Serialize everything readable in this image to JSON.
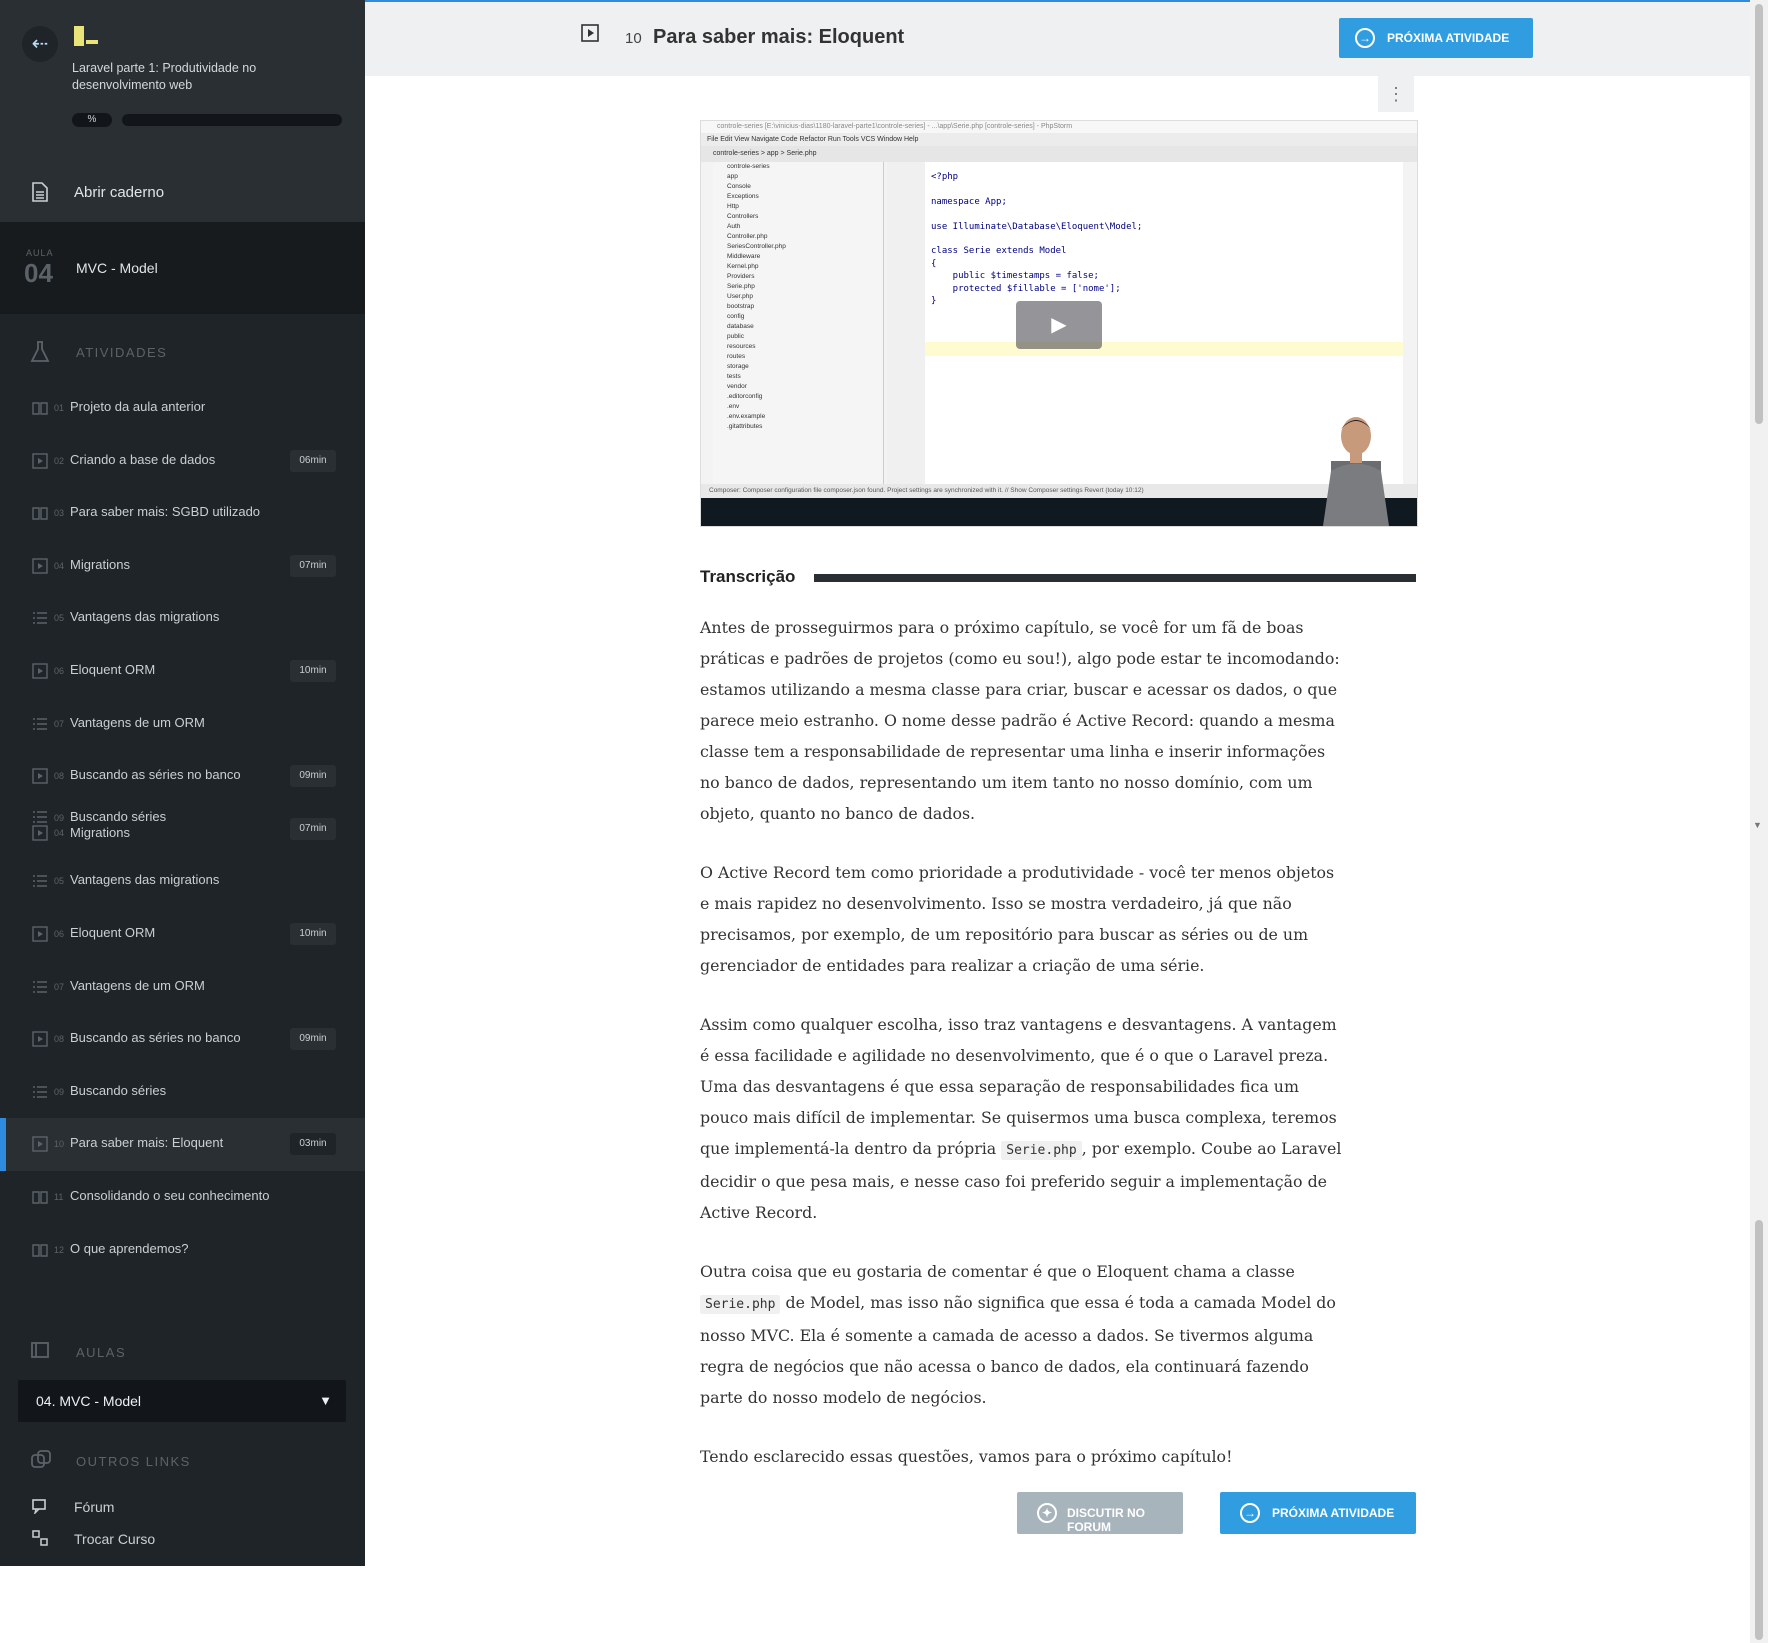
{
  "course": {
    "title": "Laravel parte 1: Produtividade no desenvolvimento web",
    "progress_label": "%",
    "progress_fraction": 0
  },
  "notebook": {
    "label": "Abrir caderno"
  },
  "aula": {
    "small": "AULA",
    "number": "04",
    "title": "MVC - Model"
  },
  "activities": {
    "heading": "ATIVIDADES",
    "items": [
      {
        "no": "01",
        "label": "Projeto da aula anterior",
        "duration": "",
        "icon": "book-icon"
      },
      {
        "no": "02",
        "label": "Criando a base de dados",
        "duration": "06min",
        "icon": "video-icon"
      },
      {
        "no": "03",
        "label": "Para saber mais: SGBD utilizado",
        "duration": "",
        "icon": "book-icon"
      },
      {
        "no": "04",
        "label": "Migrations",
        "duration": "07min",
        "icon": "video-icon"
      },
      {
        "no": "05",
        "label": "Vantagens das migrations",
        "duration": "",
        "icon": "list-icon"
      },
      {
        "no": "06",
        "label": "Eloquent ORM",
        "duration": "10min",
        "icon": "video-icon"
      },
      {
        "no": "07",
        "label": "Vantagens de um ORM",
        "duration": "",
        "icon": "list-icon"
      },
      {
        "no": "08",
        "label": "Buscando as séries no banco",
        "duration": "09min",
        "icon": "video-icon"
      },
      {
        "no": "09",
        "label": "Buscando séries",
        "no2": "04",
        "label2": "Migrations",
        "duration": "07min",
        "icon": "list-icon",
        "double": true
      },
      {
        "no": "05",
        "label": "Vantagens das migrations",
        "duration": "",
        "icon": "list-icon"
      },
      {
        "no": "06",
        "label": "Eloquent ORM",
        "duration": "10min",
        "icon": "video-icon"
      },
      {
        "no": "07",
        "label": "Vantagens de um ORM",
        "duration": "",
        "icon": "list-icon"
      },
      {
        "no": "08",
        "label": "Buscando as séries no banco",
        "duration": "09min",
        "icon": "video-icon"
      },
      {
        "no": "09",
        "label": "Buscando séries",
        "duration": "",
        "icon": "list-icon"
      },
      {
        "no": "10",
        "label": "Para saber mais: Eloquent",
        "duration": "03min",
        "icon": "video-icon",
        "active": true
      },
      {
        "no": "11",
        "label": "Consolidando o seu conhecimento",
        "duration": "",
        "icon": "book-icon"
      },
      {
        "no": "12",
        "label": "O que aprendemos?",
        "duration": "",
        "icon": "book-icon"
      }
    ]
  },
  "aulas": {
    "heading": "AULAS",
    "selected": "04. MVC - Model"
  },
  "other_links": {
    "heading": "OUTROS LINKS",
    "forum": "Fórum",
    "switch_course": "Trocar Curso"
  },
  "header": {
    "activity_number": "10",
    "activity_title": "Para saber mais: Eloquent",
    "next_label": "PRÓXIMA ATIVIDADE"
  },
  "video": {
    "ide_title": "controle-series [E:\\vinicius-dias\\1180-laravel-parte1\\controle-series] - ...\\app\\Serie.php [controle-series] - PhpStorm",
    "ide_menu": "File  Edit  View  Navigate  Code  Refactor  Run  Tools  VCS  Window  Help",
    "ide_nav": "controle-series  >  app  >  Serie.php",
    "tree": [
      "controle-series",
      "app",
      "Console",
      "Exceptions",
      "Http",
      "Controllers",
      "Auth",
      "Controller.php",
      "SeriesController.php",
      "Middleware",
      "Kernel.php",
      "Providers",
      "Serie.php",
      "User.php",
      "bootstrap",
      "config",
      "database",
      "public",
      "resources",
      "routes",
      "storage",
      "tests",
      "vendor",
      ".editorconfig",
      ".env",
      ".env.example",
      ".gitattributes"
    ],
    "code": [
      "<?php",
      "",
      "namespace App;",
      "",
      "use Illuminate\\Database\\Eloquent\\Model;",
      "",
      "class Serie extends Model",
      "{",
      "    public $timestamps = false;",
      "    protected $fillable = ['nome'];",
      "}",
      ""
    ],
    "status": "Composer: Composer configuration file composer.json found. Project settings are synchronized with it. // Show Composer settings Revert (today 10:12)"
  },
  "transcript": {
    "heading": "Transcrição",
    "p1": "Antes de prosseguirmos para o próximo capítulo, se você for um fã de boas práticas e padrões de projetos (como eu sou!), algo pode estar te incomodando: estamos utilizando a mesma classe para criar, buscar e acessar os dados, o que parece meio estranho. O nome desse padrão é Active Record: quando a mesma classe tem a responsabilidade de representar uma linha e inserir informações no banco de dados, representando um item tanto no nosso domínio, com um objeto, quanto no banco de dados.",
    "p2": "O Active Record tem como prioridade a produtividade - você ter menos objetos e mais rapidez no desenvolvimento. Isso se mostra verdadeiro, já que não precisamos, por exemplo, de um repositório para buscar as séries ou de um gerenciador de entidades para realizar a criação de uma série.",
    "p3a": "Assim como qualquer escolha, isso traz vantagens e desvantagens. A vantagem é essa facilidade e agilidade no desenvolvimento, que é o que o Laravel preza. Uma das desvantagens é que essa separação de responsabilidades fica um pouco mais difícil de implementar. Se quisermos uma busca complexa, teremos que implementá-la dentro da própria ",
    "p3code": "Serie.php",
    "p3b": ", por exemplo. Coube ao Laravel decidir o que pesa mais, e nesse caso foi preferido seguir a implementação de Active Record.",
    "p4a": "Outra coisa que eu gostaria de comentar é que o Eloquent chama a classe ",
    "p4code": "Serie.php",
    "p4b": " de Model, mas isso não significa que essa é toda a camada Model do nosso MVC. Ela é somente a camada de acesso a dados. Se tivermos alguma regra de negócios que não acessa o banco de dados, ela continuará fazendo parte do nosso modelo de negócios.",
    "p5": "Tendo esclarecido essas questões, vamos para o próximo capítulo!"
  },
  "footer": {
    "forum_label": "DISCUTIR NO FORUM",
    "next_label": "PRÓXIMA ATIVIDADE"
  },
  "colors": {
    "accent": "#2f9de0",
    "sidebar": "#1f2428",
    "active_marker": "#2f8be0"
  }
}
